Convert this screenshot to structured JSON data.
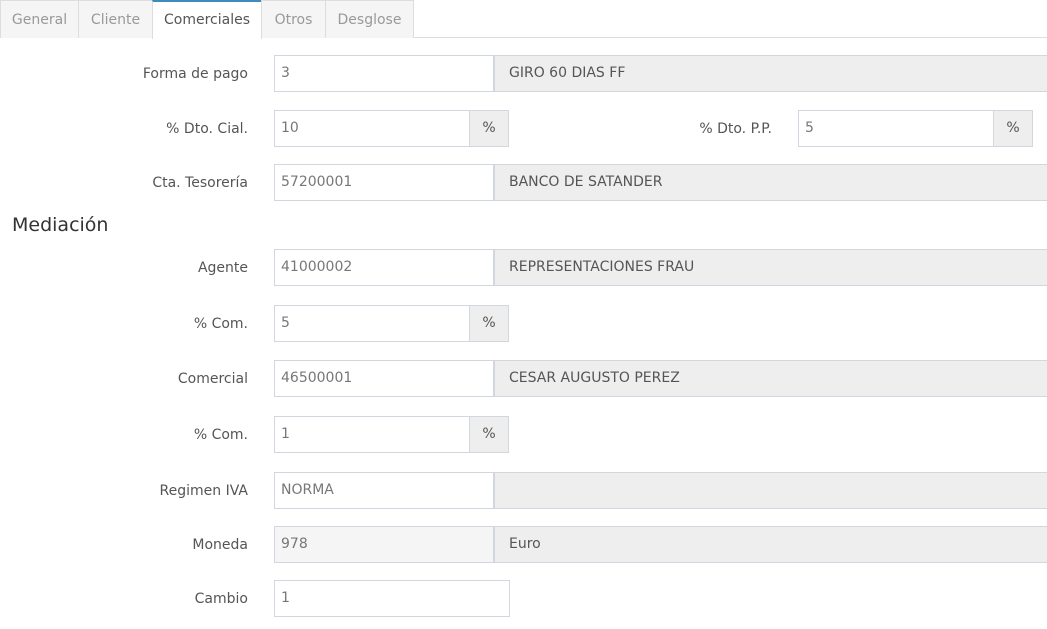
{
  "tabs": [
    "General",
    "Cliente",
    "Comerciales",
    "Otros",
    "Desglose"
  ],
  "active_tab": "Comerciales",
  "forma_pago": {
    "label": "Forma de pago",
    "value": "3",
    "description": "GIRO 60 DIAS FF"
  },
  "dto_cial": {
    "label": "% Dto. Cial.",
    "value": "10",
    "unit": "%"
  },
  "dto_pp": {
    "label": "% Dto. P.P.",
    "value": "5",
    "unit": "%"
  },
  "cta_tesoreria": {
    "label": "Cta. Tesorería",
    "value": "57200001",
    "description": "BANCO DE SATANDER"
  },
  "mediacion": {
    "title": "Mediación"
  },
  "agente": {
    "label": "Agente",
    "value": "41000002",
    "description": "REPRESENTACIONES FRAU"
  },
  "com_agente": {
    "label": "% Com.",
    "value": "5",
    "unit": "%"
  },
  "comercial": {
    "label": "Comercial",
    "value": "46500001",
    "description": "CESAR AUGUSTO PEREZ"
  },
  "com_comercial": {
    "label": "% Com.",
    "value": "1",
    "unit": "%"
  },
  "regimen_iva": {
    "label": "Regimen IVA",
    "value": "NORMA",
    "description": ""
  },
  "moneda": {
    "label": "Moneda",
    "value": "978",
    "description": "Euro"
  },
  "cambio": {
    "label": "Cambio",
    "value": "1"
  }
}
